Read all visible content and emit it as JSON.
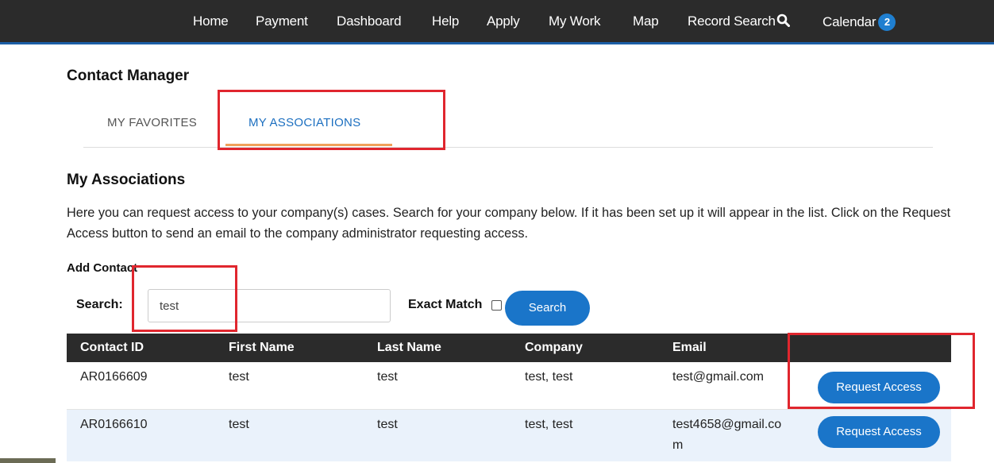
{
  "nav": {
    "items": [
      "Home",
      "Payment",
      "Dashboard",
      "Help",
      "Apply",
      "My Work",
      "Map"
    ],
    "record_search": "Record Search",
    "calendar": "Calendar",
    "calendar_badge": "2"
  },
  "page": {
    "title": "Contact Manager"
  },
  "tabs": {
    "favorites": "MY FAVORITES",
    "associations": "MY ASSOCIATIONS"
  },
  "section": {
    "title": "My Associations",
    "description": "Here you can request access to your company(s) cases. Search for your company below. If it has been set up it will appear in the list. Click on the Request Access button to send an email to the company administrator requesting access."
  },
  "search_form": {
    "add_contact_label": "Add Contact",
    "search_label": "Search:",
    "search_value": "test",
    "exact_match_label": "Exact Match",
    "exact_match_checked": false,
    "search_button": "Search"
  },
  "table": {
    "headers": [
      "Contact ID",
      "First Name",
      "Last Name",
      "Company",
      "Email",
      ""
    ],
    "rows": [
      {
        "contact_id": "AR0166609",
        "first_name": "test",
        "last_name": "test",
        "company": "test, test",
        "email": "test@gmail.com",
        "action": "Request Access"
      },
      {
        "contact_id": "AR0166610",
        "first_name": "test",
        "last_name": "test",
        "company": "test, test",
        "email": "test4658@gmail.com",
        "action": "Request Access"
      }
    ]
  },
  "colors": {
    "nav_bg": "#2b2b2b",
    "accent_blue": "#1a75c9",
    "tab_underline": "#f0a05a",
    "highlight_red": "#e0262e",
    "row_alt": "#eaf2fb"
  }
}
